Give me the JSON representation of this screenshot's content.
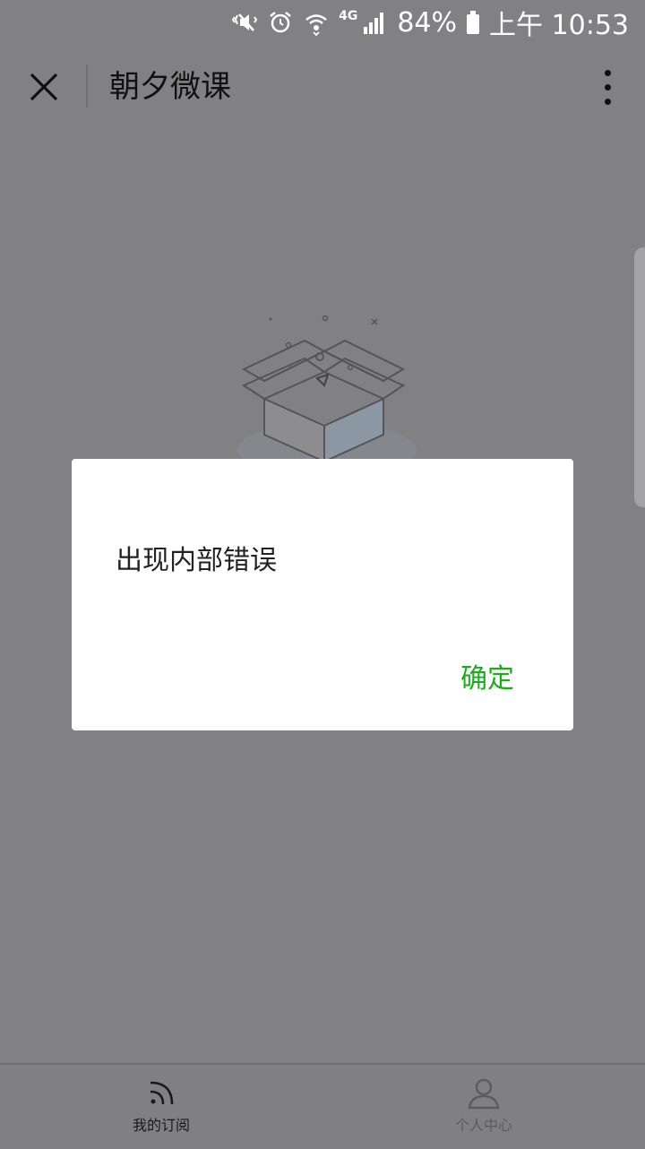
{
  "status_bar": {
    "network": "4G",
    "battery_percent": "84%",
    "time": "上午 10:53",
    "icons": [
      "mute-vibrate-icon",
      "alarm-icon",
      "wifi-icon",
      "signal-icon",
      "battery-icon"
    ]
  },
  "title_bar": {
    "title": "朝夕微课",
    "icons": [
      "close-icon",
      "more-icon"
    ]
  },
  "dialog": {
    "message": "出现内部错误",
    "confirm_label": "确定",
    "accent_color": "#1aad19"
  },
  "tab_bar": {
    "tabs": [
      {
        "label": "我的订阅",
        "icon": "rss-icon",
        "active": true
      },
      {
        "label": "个人中心",
        "icon": "person-icon",
        "active": false
      }
    ]
  },
  "colors": {
    "overlay": "#818183",
    "dialog_bg": "#ffffff"
  }
}
